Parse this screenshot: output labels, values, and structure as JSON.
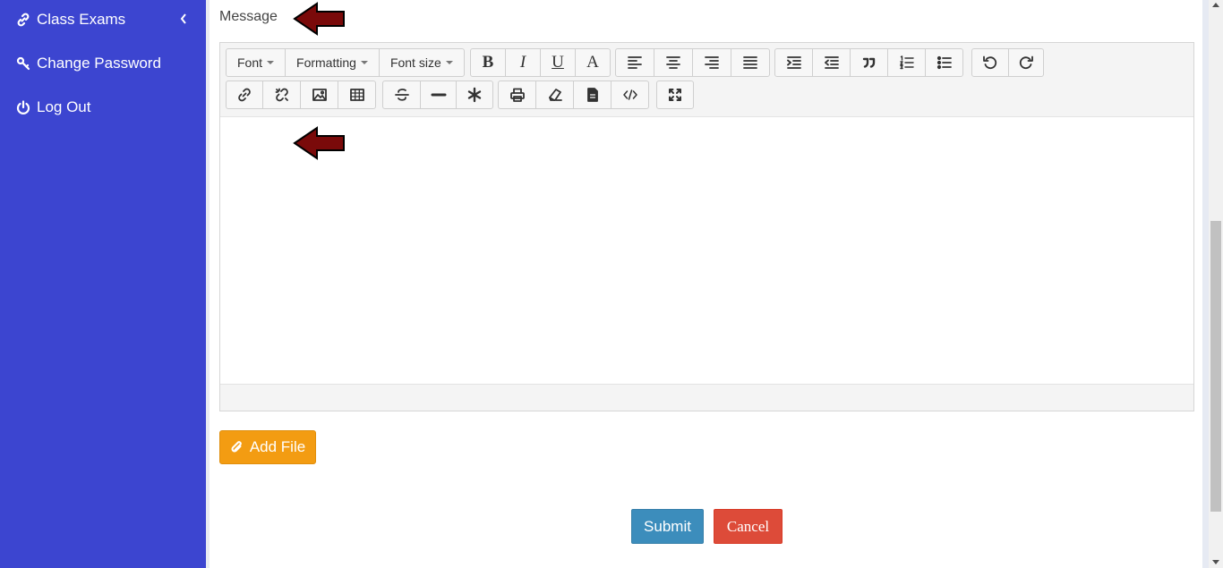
{
  "sidebar": {
    "items": [
      {
        "label": "Class Exams",
        "icon": "link-icon"
      },
      {
        "label": "Change Password",
        "icon": "key-icon"
      },
      {
        "label": "Log Out",
        "icon": "power-icon"
      }
    ],
    "bg_color": "#3c45d0"
  },
  "form": {
    "message_label": "Message",
    "add_file_label": "Add File",
    "submit_label": "Submit",
    "cancel_label": "Cancel"
  },
  "editor": {
    "toolbar_row1": {
      "dropdowns": [
        "Font",
        "Formatting",
        "Font size"
      ],
      "style_buttons": [
        "B",
        "I",
        "U",
        "A"
      ],
      "icons": [
        "align-left-icon",
        "align-center-icon",
        "align-right-icon",
        "align-justify-icon",
        "indent-icon",
        "outdent-icon",
        "blockquote-icon",
        "ordered-list-icon",
        "unordered-list-icon",
        "undo-icon",
        "redo-icon"
      ]
    },
    "toolbar_row2": {
      "icons": [
        "link-icon",
        "unlink-icon",
        "image-icon",
        "table-icon",
        "strikethrough-icon",
        "horizontal-rule-icon",
        "special-char-icon",
        "print-icon",
        "eraser-icon",
        "document-icon",
        "code-icon",
        "fullscreen-icon"
      ]
    }
  },
  "colors": {
    "accent_submit": "#3c8dbc",
    "danger_cancel": "#dd4b39",
    "warning_add": "#f39c12",
    "annotation_arrow": "#7a0a0a"
  }
}
